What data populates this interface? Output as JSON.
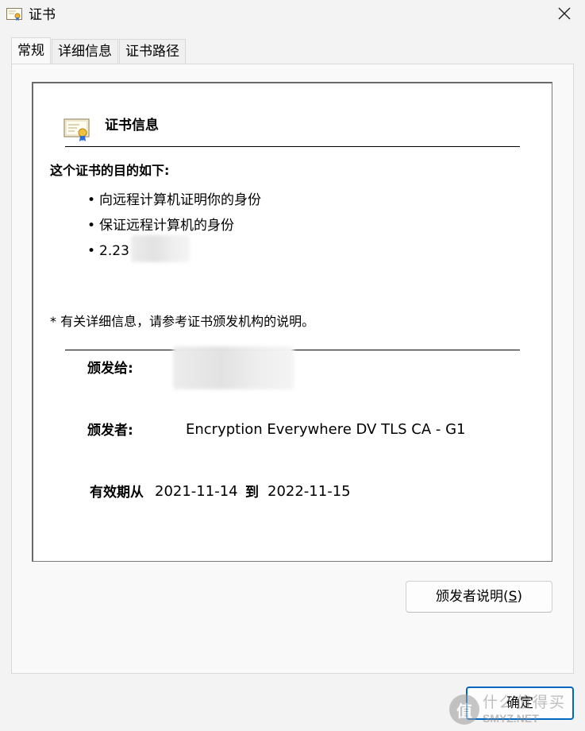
{
  "window": {
    "title": "证书",
    "close_glyph": "✕"
  },
  "tabs": [
    {
      "label": "常规",
      "active": true
    },
    {
      "label": "详细信息",
      "active": false
    },
    {
      "label": "证书路径",
      "active": false
    }
  ],
  "general": {
    "header_title": "证书信息",
    "purpose_title": "这个证书的目的如下:",
    "purposes": [
      "向远程计算机证明你的身份",
      "保证远程计算机的身份",
      "2.23"
    ],
    "note": "* 有关详细信息，请参考证书颁发机构的说明。",
    "issued_to_label": "颁发给:",
    "issued_to_value": "",
    "issued_by_label": "颁发者:",
    "issued_by_value": "Encryption Everywhere DV TLS CA - G1",
    "valid_from_label": "有效期从",
    "valid_from": "2021-11-14",
    "valid_to_label": "到",
    "valid_to": "2022-11-15"
  },
  "buttons": {
    "issuer_statement_label": "颁发者说明(",
    "issuer_statement_accel": "S",
    "issuer_statement_suffix": ")",
    "ok_label": "确定"
  },
  "watermark": {
    "badge": "值",
    "top": "什么值得买",
    "bottom": "SMYZ.NET"
  },
  "icons": {
    "title": "certificate-icon",
    "header": "certificate-icon",
    "close": "close-icon"
  }
}
